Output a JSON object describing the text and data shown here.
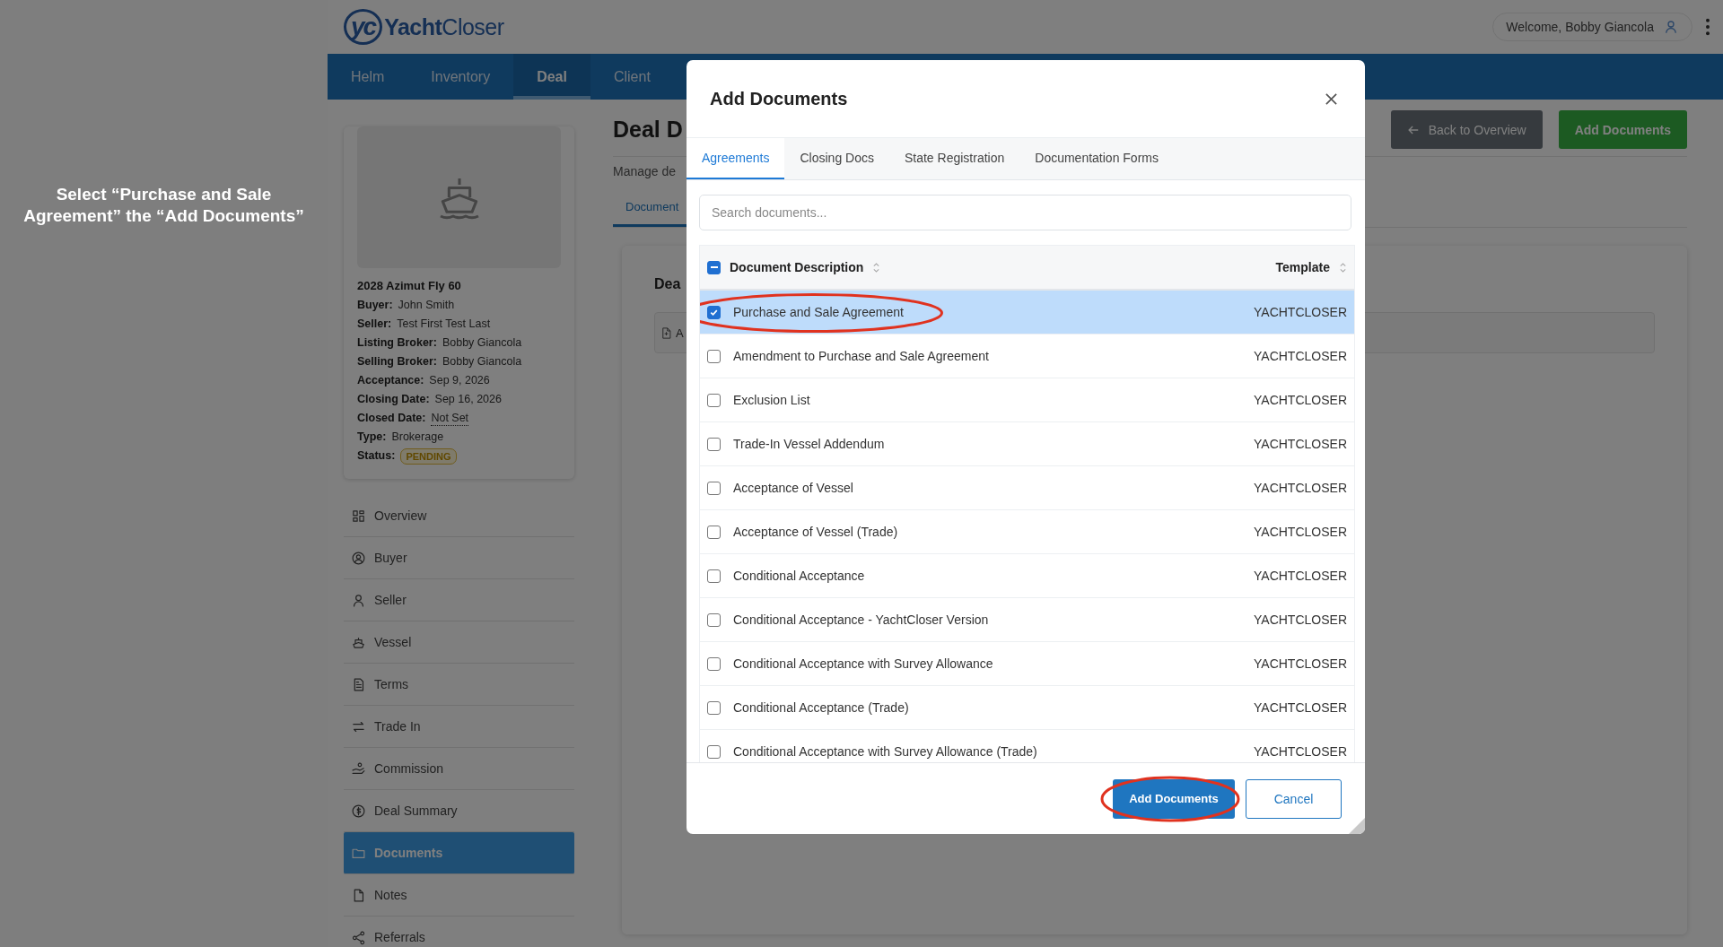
{
  "annotation": "Select “Purchase and Sale Agreement” the “Add Documents”",
  "header": {
    "logo_mark": "yc",
    "logo_text": "**Yacht**Closer",
    "welcome": "Welcome, Bobby Giancola"
  },
  "nav": [
    {
      "label": "Helm",
      "selected": false
    },
    {
      "label": "Inventory",
      "selected": false
    },
    {
      "label": "Deal",
      "selected": true
    },
    {
      "label": "Client",
      "selected": false
    }
  ],
  "vessel_card": {
    "title": "2028 Azimut Fly 60",
    "fields": [
      {
        "label": "Buyer:",
        "value": "John Smith",
        "kind": "text"
      },
      {
        "label": "Seller:",
        "value": "Test First Test Last",
        "kind": "text"
      },
      {
        "label": "Listing Broker:",
        "value": "Bobby Giancola",
        "kind": "text"
      },
      {
        "label": "Selling Broker:",
        "value": "Bobby Giancola",
        "kind": "text"
      },
      {
        "label": "Acceptance:",
        "value": "Sep 9, 2026",
        "kind": "text"
      },
      {
        "label": "Closing Date:",
        "value": "Sep 16, 2026",
        "kind": "text"
      },
      {
        "label": "Closed Date:",
        "value": "Not Set",
        "kind": "unset"
      },
      {
        "label": "Type:",
        "value": "Brokerage",
        "kind": "text"
      },
      {
        "label": "Status:",
        "value": "PENDING",
        "kind": "badge"
      }
    ]
  },
  "sidebar": [
    {
      "label": "Overview",
      "selected": false
    },
    {
      "label": "Buyer",
      "selected": false
    },
    {
      "label": "Seller",
      "selected": false
    },
    {
      "label": "Vessel",
      "selected": false
    },
    {
      "label": "Terms",
      "selected": false
    },
    {
      "label": "Trade In",
      "selected": false
    },
    {
      "label": "Commission",
      "selected": false
    },
    {
      "label": "Deal Summary",
      "selected": false
    },
    {
      "label": "Documents",
      "selected": true
    },
    {
      "label": "Notes",
      "selected": false
    },
    {
      "label": "Referrals",
      "selected": false
    }
  ],
  "main": {
    "title": "Deal D",
    "subtitle": "Manage de",
    "tab": "Document",
    "card_title": "Dea",
    "row_text": "A",
    "back_button": "Back to Overview",
    "add_button": "Add Documents"
  },
  "modal": {
    "title": "Add Documents",
    "tabs": [
      {
        "label": "Agreements",
        "selected": true
      },
      {
        "label": "Closing Docs",
        "selected": false
      },
      {
        "label": "State Registration",
        "selected": false
      },
      {
        "label": "Documentation Forms",
        "selected": false
      }
    ],
    "search": {
      "placeholder": "Search documents..."
    },
    "select_all_indeterminate": true,
    "columns": [
      "Document Description",
      "Template"
    ],
    "rows": [
      {
        "description": "Purchase and Sale Agreement",
        "template": "YACHTCLOSER",
        "checked": true,
        "circled": true
      },
      {
        "description": "Amendment to Purchase and Sale Agreement",
        "template": "YACHTCLOSER",
        "checked": false,
        "circled": false
      },
      {
        "description": "Exclusion List",
        "template": "YACHTCLOSER",
        "checked": false,
        "circled": false
      },
      {
        "description": "Trade-In Vessel Addendum",
        "template": "YACHTCLOSER",
        "checked": false,
        "circled": false
      },
      {
        "description": "Acceptance of Vessel",
        "template": "YACHTCLOSER",
        "checked": false,
        "circled": false
      },
      {
        "description": "Acceptance of Vessel (Trade)",
        "template": "YACHTCLOSER",
        "checked": false,
        "circled": false
      },
      {
        "description": "Conditional Acceptance",
        "template": "YACHTCLOSER",
        "checked": false,
        "circled": false
      },
      {
        "description": "Conditional Acceptance - YachtCloser Version",
        "template": "YACHTCLOSER",
        "checked": false,
        "circled": false
      },
      {
        "description": "Conditional Acceptance with Survey Allowance",
        "template": "YACHTCLOSER",
        "checked": false,
        "circled": false
      },
      {
        "description": "Conditional Acceptance (Trade)",
        "template": "YACHTCLOSER",
        "checked": false,
        "circled": false
      },
      {
        "description": "Conditional Acceptance with Survey Allowance (Trade)",
        "template": "YACHTCLOSER",
        "checked": false,
        "circled": false
      }
    ],
    "primary_button": {
      "label": "Add Documents",
      "circled": true
    },
    "cancel_button": {
      "label": "Cancel"
    }
  }
}
